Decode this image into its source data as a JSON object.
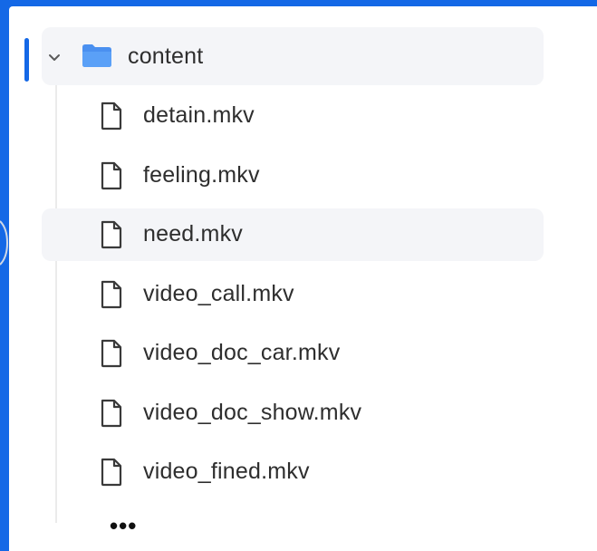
{
  "colors": {
    "frame": "#1468e6",
    "panel": "#ffffff",
    "highlight": "#f4f5f8",
    "folder": "#4a90f0",
    "text": "#2e2e2e"
  },
  "tree": {
    "folder": {
      "label": "content",
      "expanded": true,
      "icon": "folder-icon"
    },
    "files": [
      {
        "label": "detain.mkv",
        "icon": "file-icon",
        "highlighted": false
      },
      {
        "label": "feeling.mkv",
        "icon": "file-icon",
        "highlighted": false
      },
      {
        "label": "need.mkv",
        "icon": "file-icon",
        "highlighted": true
      },
      {
        "label": "video_call.mkv",
        "icon": "file-icon",
        "highlighted": false
      },
      {
        "label": "video_doc_car.mkv",
        "icon": "file-icon",
        "highlighted": false
      },
      {
        "label": "video_doc_show.mkv",
        "icon": "file-icon",
        "highlighted": false
      },
      {
        "label": "video_fined.mkv",
        "icon": "file-icon",
        "highlighted": false
      }
    ],
    "more_label": "•••"
  }
}
